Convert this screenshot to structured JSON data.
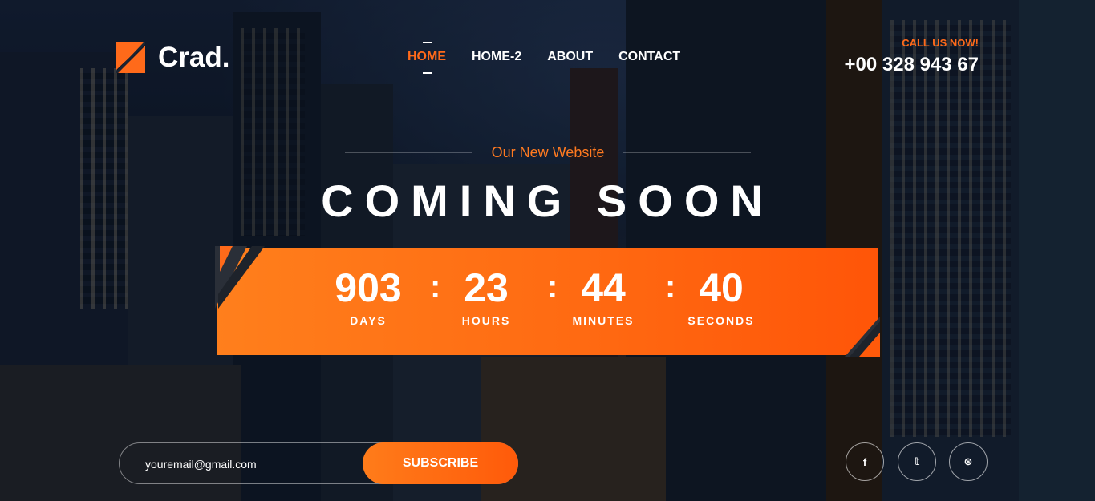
{
  "brand": {
    "name": "Crad.",
    "accent": "#ff6a1a"
  },
  "nav": {
    "items": [
      {
        "label": "HOME",
        "active": true
      },
      {
        "label": "HOME-2",
        "active": false
      },
      {
        "label": "ABOUT",
        "active": false
      },
      {
        "label": "CONTACT",
        "active": false
      }
    ]
  },
  "contact": {
    "label": "CALL US NOW!",
    "phone": "+00 328 943 67"
  },
  "hero": {
    "tagline": "Our New Website",
    "title": "COMING SOON"
  },
  "countdown": {
    "days": {
      "value": "903",
      "label": "DAYS"
    },
    "hours": {
      "value": "23",
      "label": "HOURS"
    },
    "minutes": {
      "value": "44",
      "label": "MINUTES"
    },
    "seconds": {
      "value": "40",
      "label": "SECONDS"
    },
    "separator": ":"
  },
  "subscribe": {
    "email_value": "youremail@gmail.com",
    "button_label": "SUBSCRIBE"
  },
  "social": [
    {
      "icon": "facebook-icon",
      "glyph": "f"
    },
    {
      "icon": "twitter-icon",
      "glyph": "𝕥"
    },
    {
      "icon": "dribbble-icon",
      "glyph": "⊛"
    }
  ]
}
